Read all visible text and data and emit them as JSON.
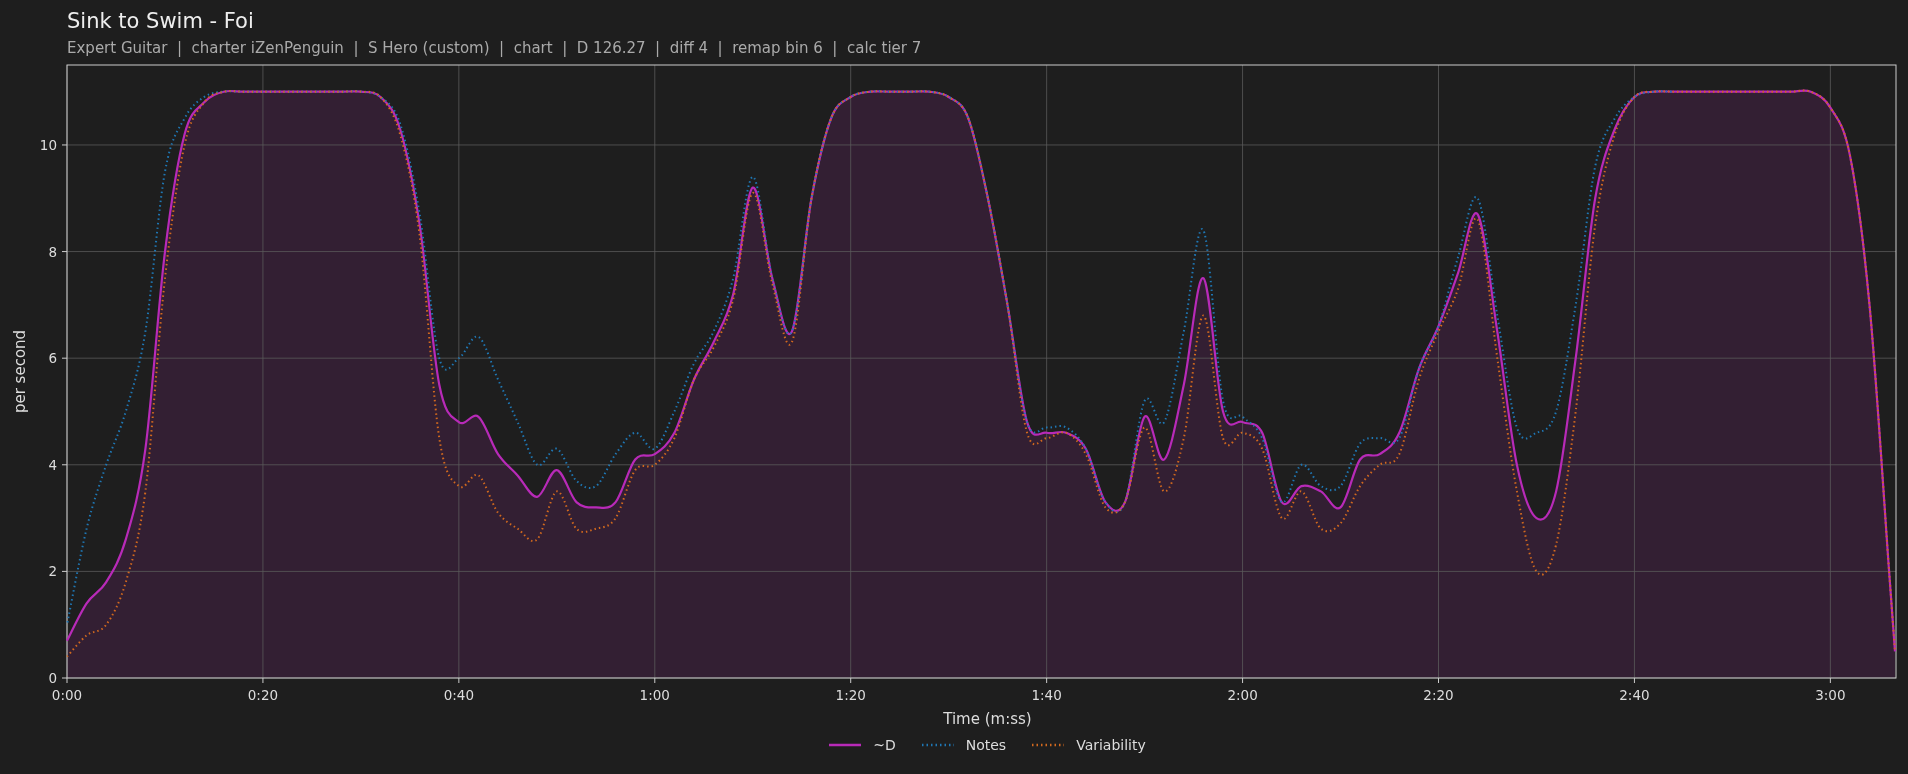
{
  "title": "Sink to Swim - Foi",
  "subtitle": "Expert Guitar  |  charter iZenPenguin  |  S Hero (custom)  |  chart  |  D 126.27  |  diff 4  |  remap bin 6  |  calc tier 7",
  "chart_data": {
    "type": "line",
    "grid": true,
    "legend": true,
    "xlabel": "Time (m:ss)",
    "ylabel": "per second",
    "x": [
      0,
      2,
      4,
      6,
      8,
      10,
      12,
      14,
      16,
      18,
      20,
      22,
      24,
      26,
      28,
      30,
      32,
      34,
      36,
      38,
      40,
      42,
      44,
      46,
      48,
      50,
      52,
      54,
      56,
      58,
      60,
      62,
      64,
      66,
      68,
      70,
      72,
      74,
      76,
      78,
      80,
      82,
      84,
      86,
      88,
      90,
      92,
      94,
      96,
      98,
      100,
      102,
      104,
      106,
      108,
      110,
      112,
      114,
      116,
      118,
      120,
      122,
      124,
      126,
      128,
      130,
      132,
      134,
      136,
      138,
      140,
      142,
      144,
      146,
      148,
      150,
      152,
      154,
      156,
      158,
      160,
      162,
      164,
      166,
      168,
      170,
      172,
      174,
      176,
      178,
      180,
      182,
      184,
      186,
      186.6
    ],
    "series": [
      {
        "name": "~D",
        "color": "#b82ab8",
        "type": "area",
        "line_style": "solid",
        "values": [
          0.7,
          1.4,
          1.8,
          2.6,
          4.3,
          8.0,
          10.2,
          10.8,
          11,
          11,
          11,
          11,
          11,
          11,
          11,
          11,
          10.9,
          10.3,
          8.5,
          5.5,
          4.8,
          4.9,
          4.2,
          3.8,
          3.4,
          3.9,
          3.3,
          3.2,
          3.3,
          4.1,
          4.2,
          4.6,
          5.6,
          6.3,
          7.2,
          9.2,
          7.5,
          6.5,
          9.0,
          10.5,
          10.9,
          11,
          11,
          11,
          11,
          10.9,
          10.5,
          9.0,
          7.0,
          4.8,
          4.6,
          4.6,
          4.3,
          3.3,
          3.3,
          4.9,
          4.1,
          5.5,
          7.5,
          5.0,
          4.8,
          4.6,
          3.3,
          3.6,
          3.5,
          3.2,
          4.1,
          4.2,
          4.6,
          5.8,
          6.6,
          7.6,
          8.7,
          6.5,
          4.0,
          3.0,
          3.5,
          6.0,
          9.0,
          10.3,
          10.9,
          11,
          11,
          11,
          11,
          11,
          11,
          11,
          11,
          11,
          10.7,
          9.8,
          7.0,
          2.0,
          0.5
        ]
      },
      {
        "name": "Notes",
        "color": "#1f77b4",
        "line_style": "dotted",
        "values": [
          1.0,
          2.8,
          4.0,
          5.0,
          6.5,
          9.5,
          10.5,
          10.9,
          11,
          11,
          11,
          11,
          11,
          11,
          11,
          11,
          10.9,
          10.4,
          8.7,
          6.0,
          6.0,
          6.4,
          5.6,
          4.8,
          4.0,
          4.3,
          3.7,
          3.6,
          4.2,
          4.6,
          4.3,
          5.0,
          5.9,
          6.5,
          7.5,
          9.4,
          7.5,
          6.5,
          9.0,
          10.5,
          10.9,
          11,
          11,
          11,
          11,
          10.9,
          10.5,
          9.0,
          7.0,
          4.8,
          4.7,
          4.7,
          4.3,
          3.3,
          3.3,
          5.2,
          4.8,
          6.5,
          8.4,
          5.2,
          4.9,
          4.5,
          3.3,
          4.0,
          3.6,
          3.6,
          4.4,
          4.5,
          4.5,
          5.8,
          6.6,
          7.9,
          9.0,
          6.8,
          4.7,
          4.6,
          5.0,
          7.0,
          9.6,
          10.5,
          10.9,
          11,
          11,
          null,
          null,
          null,
          null,
          null,
          null,
          null,
          null,
          null,
          null,
          null,
          null
        ]
      },
      {
        "name": "Variability",
        "color": "#d2691e",
        "line_style": "dotted",
        "values": [
          0.4,
          0.8,
          1.0,
          1.8,
          3.5,
          7.5,
          10.0,
          10.8,
          11,
          11,
          11,
          11,
          11,
          11,
          11,
          11,
          10.9,
          10.2,
          8.3,
          4.5,
          3.6,
          3.8,
          3.1,
          2.8,
          2.6,
          3.5,
          2.8,
          2.8,
          3.0,
          3.9,
          4.0,
          4.5,
          5.6,
          6.2,
          7.1,
          9.1,
          7.4,
          6.3,
          9.0,
          10.5,
          10.9,
          11,
          11,
          11,
          11,
          10.9,
          10.5,
          9.0,
          7.0,
          4.6,
          4.5,
          4.6,
          4.2,
          3.2,
          3.3,
          4.7,
          3.5,
          4.5,
          6.8,
          4.5,
          4.6,
          4.3,
          3.0,
          3.5,
          2.8,
          2.9,
          3.6,
          4.0,
          4.2,
          5.6,
          6.5,
          7.3,
          8.6,
          6.0,
          3.5,
          2.0,
          2.5,
          5.0,
          8.5,
          10.2,
          10.9,
          11,
          11,
          11,
          11,
          11,
          11,
          11,
          11,
          11,
          10.7,
          9.8,
          7.0,
          2.0,
          0.5
        ]
      }
    ],
    "xlim": [
      0,
      186.7
    ],
    "ylim": [
      0,
      11.5
    ],
    "xticks": [
      {
        "value": 0,
        "label": "0:00"
      },
      {
        "value": 20,
        "label": "0:20"
      },
      {
        "value": 40,
        "label": "0:40"
      },
      {
        "value": 60,
        "label": "1:00"
      },
      {
        "value": 80,
        "label": "1:20"
      },
      {
        "value": 100,
        "label": "1:40"
      },
      {
        "value": 120,
        "label": "2:00"
      },
      {
        "value": 140,
        "label": "2:20"
      },
      {
        "value": 160,
        "label": "2:40"
      },
      {
        "value": 180,
        "label": "3:00"
      }
    ],
    "yticks": [
      0,
      2,
      4,
      6,
      8,
      10
    ]
  }
}
